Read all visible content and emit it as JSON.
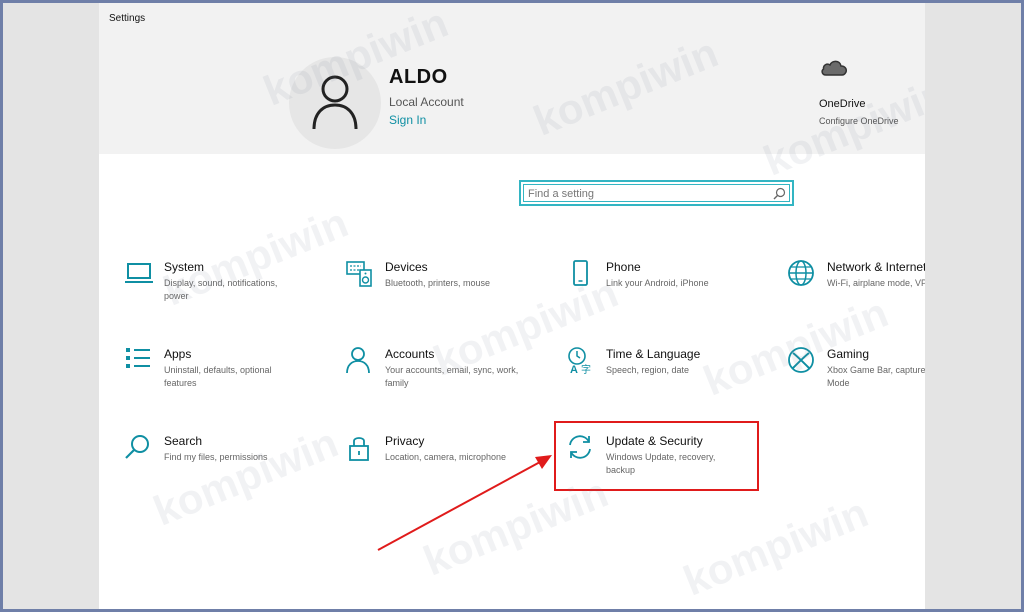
{
  "window": {
    "title": "Settings"
  },
  "account": {
    "name": "ALDO",
    "type": "Local Account",
    "sign_in": "Sign In"
  },
  "onedrive": {
    "title": "OneDrive",
    "subtitle": "Configure OneDrive"
  },
  "search": {
    "placeholder": "Find a setting"
  },
  "tiles": [
    {
      "title": "System",
      "desc": "Display, sound, notifications, power",
      "icon": "laptop-icon"
    },
    {
      "title": "Devices",
      "desc": "Bluetooth, printers, mouse",
      "icon": "keyboard-speaker-icon"
    },
    {
      "title": "Phone",
      "desc": "Link your Android, iPhone",
      "icon": "phone-icon"
    },
    {
      "title": "Network & Internet",
      "desc": "Wi-Fi, airplane mode, VPN",
      "icon": "globe-icon"
    },
    {
      "title": "Apps",
      "desc": "Uninstall, defaults, optional features",
      "icon": "apps-list-icon"
    },
    {
      "title": "Accounts",
      "desc": "Your accounts, email, sync, work, family",
      "icon": "person-icon"
    },
    {
      "title": "Time & Language",
      "desc": "Speech, region, date",
      "icon": "time-language-icon"
    },
    {
      "title": "Gaming",
      "desc": "Xbox Game Bar, captures, Game Mode",
      "icon": "xbox-icon"
    },
    {
      "title": "Search",
      "desc": "Find my files, permissions",
      "icon": "search-icon"
    },
    {
      "title": "Privacy",
      "desc": "Location, camera, microphone",
      "icon": "lock-icon"
    },
    {
      "title": "Update & Security",
      "desc": "Windows Update, recovery, backup",
      "icon": "sync-icon"
    }
  ],
  "watermark": "kompiwin",
  "colors": {
    "accent": "#0f8fa3",
    "highlight": "#e01b1b"
  }
}
